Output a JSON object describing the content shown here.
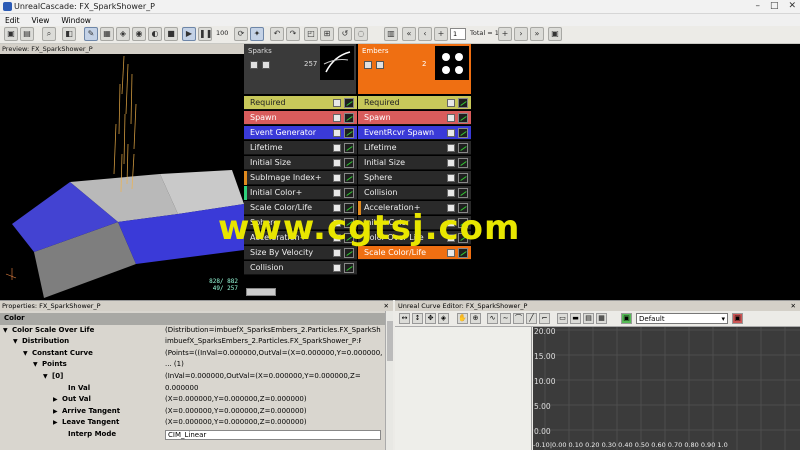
{
  "window": {
    "title": "UnrealCascade: FX_SparkShower_P",
    "min": "–",
    "max": "□",
    "close": "✕"
  },
  "menu": [
    "Edit",
    "View",
    "Window"
  ],
  "toolbar": {
    "lod_value": "1",
    "total_label": "Total = 1",
    "num_100": "100"
  },
  "preview": {
    "title": "Preview: FX_SparkShower_P",
    "stats_line1": "828/ 882",
    "stats_line2": "49/ 257"
  },
  "emitters": [
    {
      "name": "Sparks",
      "count": "257",
      "color": "#3a3a3a",
      "modules": [
        {
          "label": "Required",
          "color": "#c8c85a",
          "text": "#222"
        },
        {
          "label": "Spawn",
          "color": "#d85c5c",
          "text": "#fff"
        },
        {
          "label": "Event Generator",
          "color": "#3a3ad8",
          "text": "#fff"
        },
        {
          "label": "Lifetime",
          "color": "#2a2a2a",
          "text": "#eee"
        },
        {
          "label": "Initial Size",
          "color": "#2a2a2a",
          "text": "#eee"
        },
        {
          "label": "SubImage Index+",
          "color": "#2a2a2a",
          "text": "#eee",
          "bar": "#e08a1e"
        },
        {
          "label": "Initial Color+",
          "color": "#2a2a2a",
          "text": "#eee",
          "bar": "#2ed07a"
        },
        {
          "label": "Scale Color/Life",
          "color": "#2a2a2a",
          "text": "#eee"
        },
        {
          "label": "Sphere",
          "color": "#2a2a2a",
          "text": "#eee"
        },
        {
          "label": "Acceleration+",
          "color": "#2a2a2a",
          "text": "#eee"
        },
        {
          "label": "Size By Velocity",
          "color": "#2a2a2a",
          "text": "#eee"
        },
        {
          "label": "Collision",
          "color": "#2a2a2a",
          "text": "#eee"
        }
      ]
    },
    {
      "name": "Embers",
      "count": "2",
      "color": "#ef6f12",
      "modules": [
        {
          "label": "Required",
          "color": "#c8c85a",
          "text": "#222"
        },
        {
          "label": "Spawn",
          "color": "#d85c5c",
          "text": "#fff"
        },
        {
          "label": "EventRcvr Spawn",
          "color": "#3a3ad8",
          "text": "#fff"
        },
        {
          "label": "Lifetime",
          "color": "#2a2a2a",
          "text": "#eee"
        },
        {
          "label": "Initial Size",
          "color": "#2a2a2a",
          "text": "#eee"
        },
        {
          "label": "Sphere",
          "color": "#2a2a2a",
          "text": "#eee"
        },
        {
          "label": "Collision",
          "color": "#2a2a2a",
          "text": "#eee"
        },
        {
          "label": "Acceleration+",
          "color": "#2a2a2a",
          "text": "#eee",
          "bar": "#e08a1e"
        },
        {
          "label": "Initial Color",
          "color": "#2a2a2a",
          "text": "#eee"
        },
        {
          "label": "Color Over Life",
          "color": "#2a2a2a",
          "text": "#eee"
        },
        {
          "label": "Scale Color/Life",
          "color": "#ef6f12",
          "text": "#fff"
        }
      ]
    }
  ],
  "properties": {
    "title": "Properties: FX_SparkShower_P",
    "close": "✕",
    "rows": [
      {
        "key": "Color",
        "value": "",
        "indent": 4,
        "arrow": "▼",
        "header": true
      },
      {
        "key": "Color Scale Over Life",
        "value": "(Distribution=imbuefX_SparksEmbers_2.Particles.FX_SparkSh",
        "indent": 12,
        "arrow": "▼"
      },
      {
        "key": "Distribution",
        "value": "imbuefX_SparksEmbers_2.Particles.FX_SparkShower_P:Pa",
        "indent": 22,
        "arrow": "▼"
      },
      {
        "key": "Constant Curve",
        "value": "(Points=((InVal=0.000000,OutVal=(X=0.000000,Y=0.000000,",
        "indent": 32,
        "arrow": "▼"
      },
      {
        "key": "Points",
        "value": "... (1)",
        "indent": 42,
        "arrow": "▼"
      },
      {
        "key": "[0]",
        "value": "(InVal=0.000000,OutVal=(X=0.000000,Y=0.000000,Z=",
        "indent": 52,
        "arrow": "▼"
      },
      {
        "key": "In Val",
        "value": "0.000000",
        "indent": 68,
        "arrow": ""
      },
      {
        "key": "Out Val",
        "value": "(X=0.000000,Y=0.000000,Z=0.000000)",
        "indent": 62,
        "arrow": "▶"
      },
      {
        "key": "Arrive Tangent",
        "value": "(X=0.000000,Y=0.000000,Z=0.000000)",
        "indent": 62,
        "arrow": "▶"
      },
      {
        "key": "Leave Tangent",
        "value": "(X=0.000000,Y=0.000000,Z=0.000000)",
        "indent": 62,
        "arrow": "▶"
      },
      {
        "key": "Interp Mode",
        "value": "CIM_Linear",
        "indent": 68,
        "arrow": ""
      }
    ]
  },
  "curve_editor": {
    "title": "Unreal Curve Editor: FX_SparkShower_P",
    "close": "✕",
    "preset": "Default",
    "y_labels": [
      "20.00",
      "15.00",
      "10.00",
      "5.00",
      "0.00"
    ],
    "x_labels": "-0.10|0.00 0.10 0.20 0.30 0.40 0.50 0.60 0.70 0.80 0.90 1.0"
  },
  "watermark": "www.cgtsj.com"
}
